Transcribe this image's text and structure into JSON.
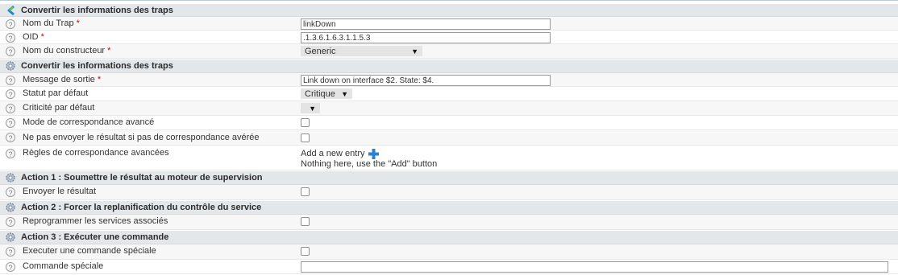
{
  "section1": {
    "title": "Convertir les informations des traps"
  },
  "trap_name": {
    "label": "Nom du Trap",
    "required": "*",
    "value": "linkDown"
  },
  "oid": {
    "label": "OID",
    "required": "*",
    "value": ".1.3.6.1.6.3.1.1.5.3"
  },
  "vendor": {
    "label": "Nom du constructeur",
    "required": "*",
    "selected": "Generic"
  },
  "section2": {
    "title": "Convertir les informations des traps"
  },
  "output_message": {
    "label": "Message de sortie",
    "required": "*",
    "value": "Link down on interface $2. State: $4."
  },
  "default_status": {
    "label": "Statut par défaut",
    "selected": "Critique"
  },
  "default_criticality": {
    "label": "Criticité par défaut",
    "selected": ""
  },
  "advanced_matching": {
    "label": "Mode de correspondance avancé",
    "checked": false
  },
  "no_send_unmatched": {
    "label": "Ne pas envoyer le résultat si pas de correspondance avérée",
    "checked": false
  },
  "advanced_rules": {
    "label": "Règles de correspondance avancées",
    "add_entry": "Add a new entry",
    "empty_text": "Nothing here, use the \"Add\" button"
  },
  "action1": {
    "title": "Action 1 : Soumettre le résultat au moteur de supervision",
    "label": "Envoyer le résultat",
    "checked": false
  },
  "action2": {
    "title": "Action 2 : Forcer la replanification du contrôle du service",
    "label": "Reprogrammer les services associés",
    "checked": false
  },
  "action3": {
    "title": "Action 3 : Exécuter une commande",
    "exec_label": "Executer une commande spéciale",
    "exec_checked": false,
    "cmd_label": "Commande spéciale",
    "cmd_value": ""
  },
  "help_glyph": "?",
  "dropdown_glyph": "▼",
  "icons": {
    "section1": "centreon-logo-icon",
    "section": "gear-icon",
    "help": "question-icon",
    "add": "plus-icon"
  },
  "colors": {
    "section_bg": "#e3e7ea",
    "required": "#d00000",
    "add_icon": "#2d7fd3",
    "logo_green": "#84bd3d",
    "logo_blue": "#1a8bc7"
  }
}
